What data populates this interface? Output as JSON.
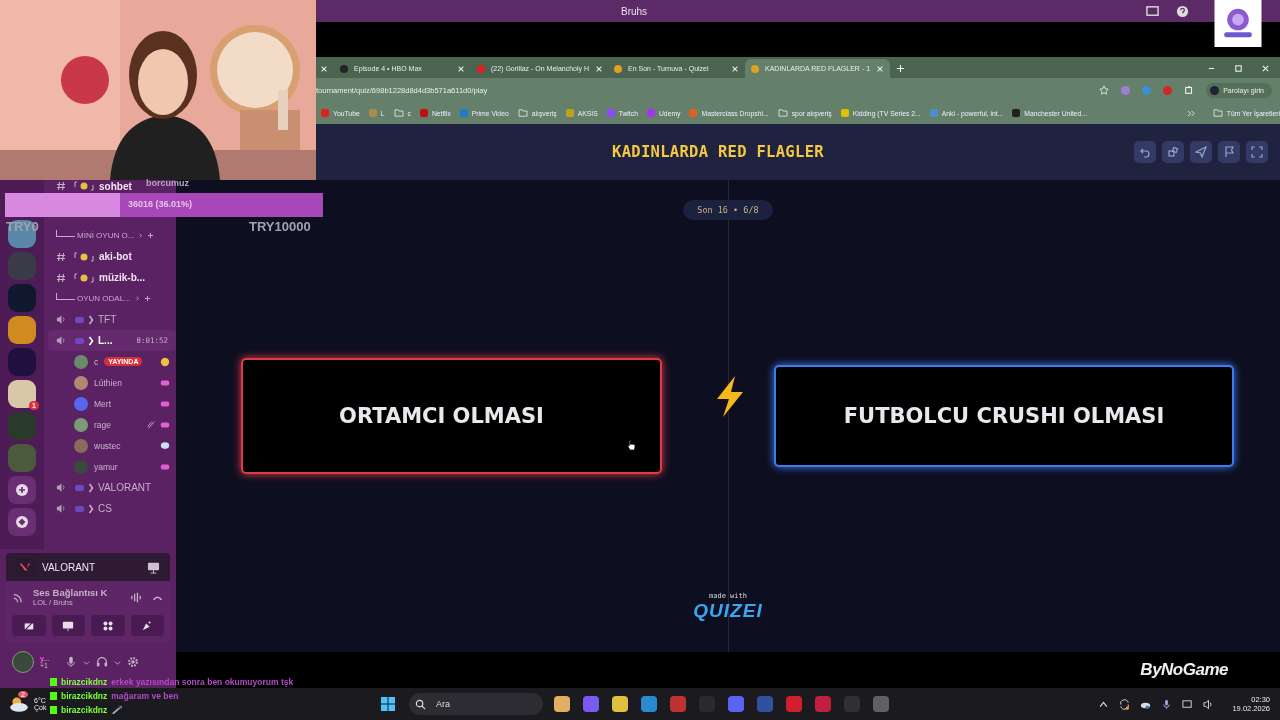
{
  "stream_title": "Bruhs",
  "browser": {
    "tabs": [
      {
        "label": "Episode 4 • HBO Max",
        "selected": false,
        "color": "#222222"
      },
      {
        "label": "(22) Gorillaz - On Melancholy H",
        "selected": false,
        "color": "#e02020"
      },
      {
        "label": "En Son - Turnuva - Quizei",
        "selected": false,
        "color": "#e0a020"
      },
      {
        "label": "KADINLARDA RED FLAGLER - 1",
        "selected": true,
        "color": "#e0a020"
      }
    ],
    "url": "tournament/quiz/698b1228d8d4d3b571a611d0/play",
    "profile_button": "Parolayı girin",
    "bookmarks": [
      {
        "label": "YouTube",
        "kind": "site",
        "color": "#e02020"
      },
      {
        "label": "L",
        "kind": "site",
        "color": "#b08a40"
      },
      {
        "label": "c",
        "kind": "folder"
      },
      {
        "label": "Netflix",
        "kind": "site",
        "color": "#c01010"
      },
      {
        "label": "Prime Video",
        "kind": "site",
        "color": "#1a7ad0"
      },
      {
        "label": "alışveriş",
        "kind": "folder"
      },
      {
        "label": "AKSİS",
        "kind": "site",
        "color": "#c0a020"
      },
      {
        "label": "Twitch",
        "kind": "site",
        "color": "#9146ff"
      },
      {
        "label": "Udemy",
        "kind": "site",
        "color": "#a435f0"
      },
      {
        "label": "Masterclass Dropshi...",
        "kind": "site",
        "color": "#e06020"
      },
      {
        "label": "spor alışveriş",
        "kind": "folder"
      },
      {
        "label": "Kidding (TV Series 2...",
        "kind": "site",
        "color": "#e0c000"
      },
      {
        "label": "Anki - powerful, int...",
        "kind": "site",
        "color": "#4a90d0"
      },
      {
        "label": "Manchester United...",
        "kind": "site",
        "color": "#202020"
      }
    ],
    "all_bookmarks": "Tüm Yer İşaretleri"
  },
  "quiz": {
    "title": "KADINLARDA RED FLAGLER",
    "round": "Son 16 • 6/8",
    "options": [
      {
        "label": "ORTAMCI OLMASI",
        "color": "#e23a44"
      },
      {
        "label": "FUTBOLCU CRUSHI OLMASI",
        "color": "#3b7cf0"
      }
    ],
    "made_with": "made with",
    "brand": "QUIZEI"
  },
  "overlay": {
    "goal_progress": {
      "label": "36016 (36.01%)",
      "level": 0.3601
    },
    "goal_start": "TRY0",
    "goal_end": "TRY10000",
    "ticker": "borcumuz"
  },
  "discord": {
    "servers": [
      {
        "kind": "avatar",
        "color": "#5a86a8"
      },
      {
        "kind": "avatar",
        "color": "#3a3a48"
      },
      {
        "kind": "avatar",
        "color": "#101830"
      },
      {
        "kind": "avatar",
        "color": "#d08a20"
      },
      {
        "kind": "avatar",
        "color": "#201040"
      },
      {
        "kind": "avatar",
        "color": "#d8c8a8",
        "badge": "1"
      },
      {
        "kind": "avatar",
        "color": "#2a3a2a"
      },
      {
        "kind": "avatar",
        "color": "#4a5a3a"
      },
      {
        "kind": "add"
      },
      {
        "kind": "discover"
      }
    ],
    "channels": [
      {
        "kind": "text",
        "name": "sohbet"
      },
      {
        "kind": "category",
        "name": "MİNİ OYUN O..."
      },
      {
        "kind": "text",
        "name": "aki-bot"
      },
      {
        "kind": "text",
        "name": "müzik-b..."
      },
      {
        "kind": "category",
        "name": "OYUN ODAL..."
      },
      {
        "kind": "voice",
        "name": "TFT"
      },
      {
        "kind": "voice",
        "name": "L...",
        "active": true,
        "timer": "8:01:52",
        "members": [
          {
            "name": "c",
            "badge": "YAYINDA",
            "kind": "emoji",
            "color": "#6a8a6a"
          },
          {
            "name": "Lúthien",
            "kind": "activity",
            "color": "#b08a70"
          },
          {
            "name": "Mert",
            "kind": "activity",
            "color": "#5865f2"
          },
          {
            "name": "rage",
            "kind": "muted",
            "color": "#7a9a7a"
          },
          {
            "name": "wustec",
            "kind": "chat",
            "color": "#8a6a5a"
          },
          {
            "name": "yamur",
            "kind": "activity",
            "color": "#3a4a3a"
          }
        ]
      },
      {
        "kind": "voice",
        "name": "VALORANT"
      },
      {
        "kind": "voice",
        "name": "CS"
      }
    ],
    "activity": "VALORANT",
    "voice": {
      "status": "Ses Bağlantısı K",
      "channel": "LOL / Bruhs"
    },
    "user": {
      "name": "y...",
      "extra": "+1"
    }
  },
  "chat": [
    {
      "user": "birazcikdnz",
      "kind": "text",
      "message": "erkek yazısından sonra ben okumuyorum tşk"
    },
    {
      "user": "birazcikdnz",
      "kind": "text",
      "message": "mağaram ve ben"
    },
    {
      "user": "birazcikdnz",
      "kind": "emote"
    }
  ],
  "sponsor_logo": "ByNoGame",
  "taskbar": {
    "weather": {
      "temp": "6°C",
      "condition": "Çok",
      "badge": "2"
    },
    "search": "Ara",
    "time": "02:30",
    "date": "19.02.2026"
  }
}
